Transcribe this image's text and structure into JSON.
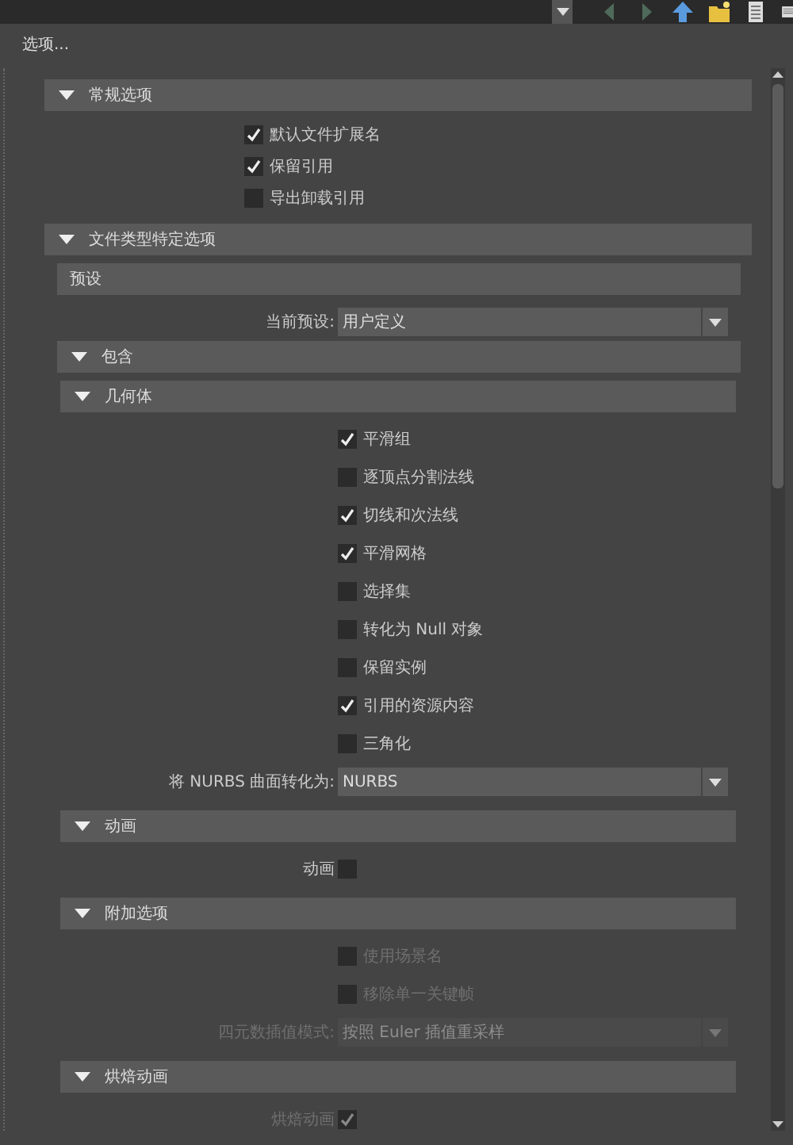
{
  "title": "选项...",
  "sections": [
    {
      "kind": "section",
      "title": "常规选项",
      "expanded": true,
      "children": [
        {
          "kind": "checkbox",
          "label": "默认文件扩展名",
          "checked": true,
          "disabled": false
        },
        {
          "kind": "checkbox",
          "label": "保留引用",
          "checked": true,
          "disabled": false
        },
        {
          "kind": "checkbox",
          "label": "导出卸载引用",
          "checked": false,
          "disabled": false
        }
      ]
    },
    {
      "kind": "section",
      "title": "文件类型特定选项",
      "expanded": true,
      "children": [
        {
          "kind": "header",
          "title": "预设"
        },
        {
          "kind": "dropdown",
          "label": "当前预设:",
          "value": "用户定义",
          "disabled": false
        },
        {
          "kind": "section",
          "title": "包含",
          "expanded": true,
          "children": [
            {
              "kind": "section",
              "title": "几何体",
              "expanded": true,
              "children": [
                {
                  "kind": "checkbox",
                  "label": "平滑组",
                  "checked": true,
                  "disabled": false
                },
                {
                  "kind": "checkbox",
                  "label": "逐顶点分割法线",
                  "checked": false,
                  "disabled": false
                },
                {
                  "kind": "checkbox",
                  "label": "切线和次法线",
                  "checked": true,
                  "disabled": false
                },
                {
                  "kind": "checkbox",
                  "label": "平滑网格",
                  "checked": true,
                  "disabled": false
                },
                {
                  "kind": "checkbox",
                  "label": "选择集",
                  "checked": false,
                  "disabled": false
                },
                {
                  "kind": "checkbox",
                  "label": "转化为 Null 对象",
                  "checked": false,
                  "disabled": false
                },
                {
                  "kind": "checkbox",
                  "label": "保留实例",
                  "checked": false,
                  "disabled": false
                },
                {
                  "kind": "checkbox",
                  "label": "引用的资源内容",
                  "checked": true,
                  "disabled": false
                },
                {
                  "kind": "checkbox",
                  "label": "三角化",
                  "checked": false,
                  "disabled": false
                },
                {
                  "kind": "dropdown",
                  "label": "将 NURBS 曲面转化为:",
                  "value": "NURBS",
                  "disabled": false
                }
              ]
            },
            {
              "kind": "section",
              "title": "动画",
              "expanded": true,
              "children": [
                {
                  "kind": "checkbox_left",
                  "label": "动画",
                  "checked": false,
                  "disabled": false
                }
              ]
            },
            {
              "kind": "section",
              "title": "附加选项",
              "expanded": true,
              "children": [
                {
                  "kind": "checkbox",
                  "label": "使用场景名",
                  "checked": false,
                  "disabled": true
                },
                {
                  "kind": "checkbox",
                  "label": "移除单一关键帧",
                  "checked": false,
                  "disabled": true
                },
                {
                  "kind": "dropdown",
                  "label": "四元数插值模式:",
                  "value": "按照 Euler 插值重采样",
                  "disabled": true
                }
              ]
            },
            {
              "kind": "section",
              "title": "烘焙动画",
              "expanded": true,
              "children": [
                {
                  "kind": "checkbox_left",
                  "label": "烘焙动画",
                  "checked": true,
                  "disabled": true
                }
              ]
            }
          ]
        }
      ]
    }
  ]
}
